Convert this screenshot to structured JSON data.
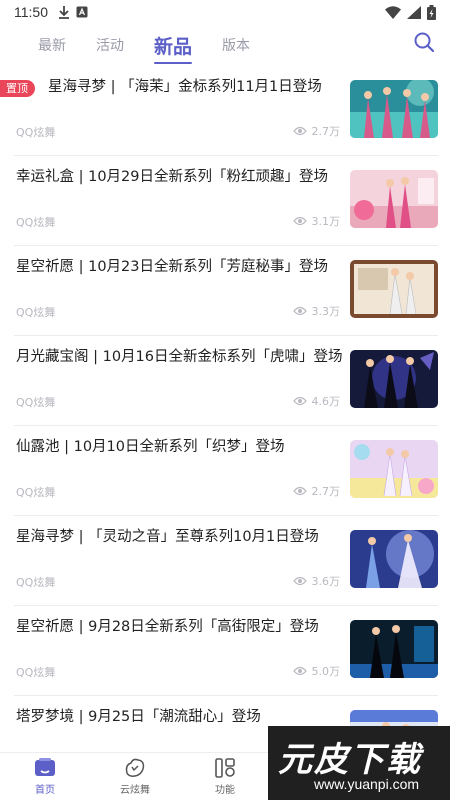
{
  "status_bar": {
    "time": "11:50"
  },
  "tabs": [
    {
      "label": "最新"
    },
    {
      "label": "活动"
    },
    {
      "label": "新品"
    },
    {
      "label": "版本"
    }
  ],
  "pin_label": "置顶",
  "feed": [
    {
      "title": "星海寻梦 | 「海茉」金标系列11月1日登场",
      "source": "QQ炫舞",
      "views": "2.7万",
      "pinned": true
    },
    {
      "title": "幸运礼盒 | 10月29日全新系列「粉红顽趣」登场",
      "source": "QQ炫舞",
      "views": "3.1万"
    },
    {
      "title": "星空祈愿 | 10月23日全新系列「芳庭秘事」登场",
      "source": "QQ炫舞",
      "views": "3.3万"
    },
    {
      "title": "月光藏宝阁 | 10月16日全新金标系列「虎啸」登场",
      "source": "QQ炫舞",
      "views": "4.6万"
    },
    {
      "title": "仙露池 | 10月10日全新系列「织梦」登场",
      "source": "QQ炫舞",
      "views": "2.7万"
    },
    {
      "title": "星海寻梦 | 「灵动之音」至尊系列10月1日登场",
      "source": "QQ炫舞",
      "views": "3.6万"
    },
    {
      "title": "星空祈愿 | 9月28日全新系列「高街限定」登场",
      "source": "QQ炫舞",
      "views": "5.0万"
    },
    {
      "title": "塔罗梦境 | 9月25日「潮流甜心」登场",
      "source": "",
      "views": ""
    }
  ],
  "bottom_nav": [
    {
      "label": "首页"
    },
    {
      "label": "云炫舞"
    },
    {
      "label": "功能"
    }
  ],
  "watermark": {
    "logo": "元皮下载",
    "url": "www.yuanpi.com"
  },
  "colors": {
    "accent": "#5b5fc7",
    "pin": "#e9465a",
    "muted": "#b8b8c0"
  }
}
